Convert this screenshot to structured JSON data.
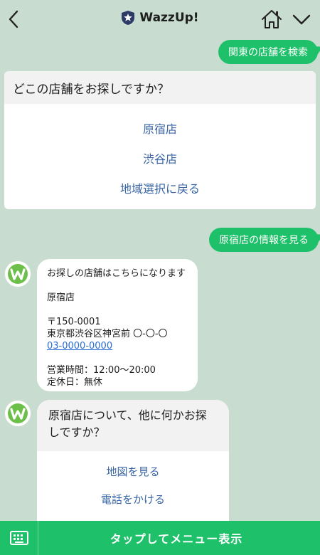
{
  "header": {
    "title": "WazzUp!",
    "back_icon": "chevron-left-icon",
    "home_icon": "home-icon",
    "menu_icon": "chevron-down-icon",
    "brand_color": "#2b3a67"
  },
  "messages": {
    "user1": "関東の店舗を検索",
    "user2": "原宿店の情報を見る"
  },
  "card1": {
    "question": "どこの店舗をお探しですか？",
    "options": [
      "原宿店",
      "渋谷店",
      "地域選択に戻る"
    ]
  },
  "info": {
    "intro": "お探しの店舗はこちらになります",
    "store": "原宿店",
    "postal": "〒150-0001",
    "address": "東京都渋谷区神宮前 〇-〇-〇",
    "phone": "03-0000-0000",
    "hours": "営業時間：12:00〜20:00",
    "holiday": "定休日：無休"
  },
  "card2": {
    "question": "原宿店について、他に何かお探しですか？",
    "options": [
      "地図を見る",
      "電話をかける"
    ]
  },
  "bottom": {
    "menu_label": "タップしてメニュー表示",
    "keyboard_icon": "keyboard-icon"
  },
  "colors": {
    "background": "#c8ddd0",
    "accent": "#1fc06a",
    "link": "#3a66a6",
    "avatar_w": "#6cc04a"
  }
}
